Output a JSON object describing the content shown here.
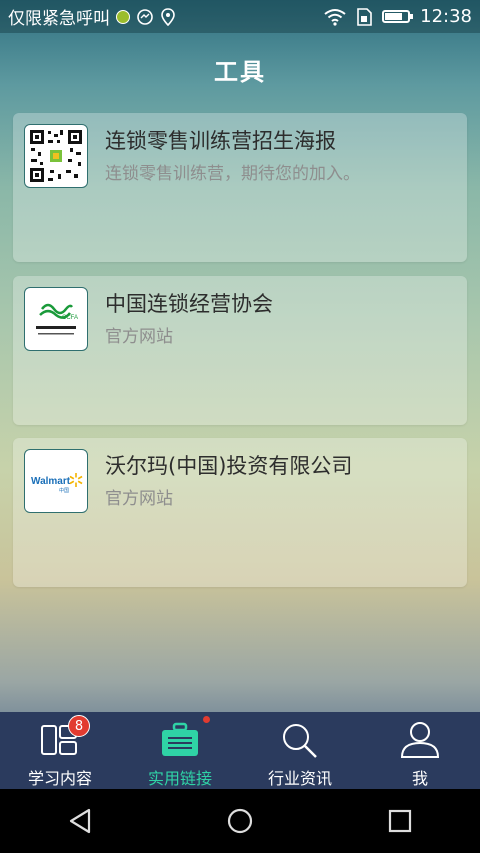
{
  "status_bar": {
    "carrier_text": "仅限紧急呼叫",
    "time": "12:38",
    "battery_level": 0.75,
    "icons": [
      "carrier-badge-icon",
      "messenger-icon",
      "location-icon",
      "wifi-icon",
      "sim-card-icon",
      "battery-icon"
    ]
  },
  "page": {
    "title": "工具"
  },
  "cards": [
    {
      "title": "连锁零售训练营招生海报",
      "subtitle": "连锁零售训练营，期待您的加入。",
      "thumb": "qr-code-icon"
    },
    {
      "title": "中国连锁经营协会",
      "subtitle": "官方网站",
      "thumb": "ccfa-logo",
      "logo_text": "CCFA"
    },
    {
      "title": "沃尔玛(中国)投资有限公司",
      "subtitle": "官方网站",
      "thumb": "walmart-logo",
      "logo_text": "Walmart",
      "logo_sub": "中国"
    }
  ],
  "tabs": [
    {
      "label": "学习内容",
      "icon": "layout-icon",
      "badge": "8",
      "active": false
    },
    {
      "label": "实用链接",
      "icon": "briefcase-icon",
      "active": true,
      "has_dot": true
    },
    {
      "label": "行业资讯",
      "icon": "search-icon",
      "active": false
    },
    {
      "label": "我",
      "icon": "user-icon",
      "active": false
    }
  ],
  "colors": {
    "accent": "#2fd3a6",
    "badge": "#e23b30",
    "tabbar": "#2b3b5e"
  }
}
